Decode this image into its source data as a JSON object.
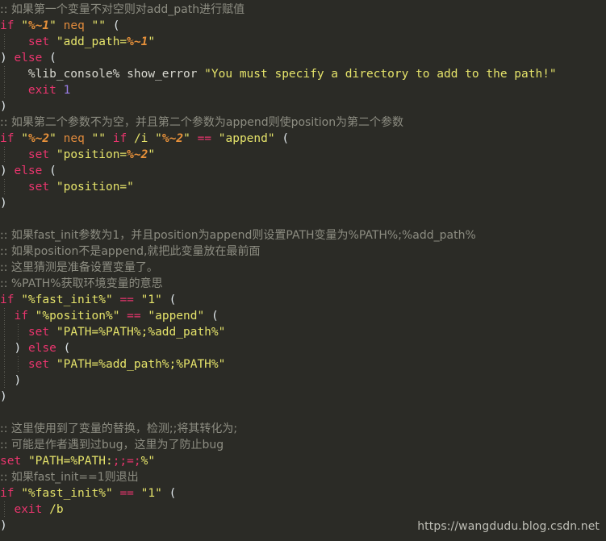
{
  "editor": {
    "background": "#2b2b26",
    "colors": {
      "comment": "#8d8d82",
      "keyword": "#e8356d",
      "string": "#e5e36a",
      "variable": "#e8913a",
      "operator": "#e08a3c",
      "number": "#9a7ee8",
      "plain": "#d8d8d0",
      "paren": "#dfe6ea"
    },
    "language": "batch",
    "lines": [
      {
        "indent": 0,
        "guides": 0,
        "tokens": [
          {
            "t": "cmt",
            "s": ":: 如果第一个变量不对空则对add_path进行赋值"
          }
        ]
      },
      {
        "indent": 0,
        "guides": 0,
        "tokens": [
          {
            "t": "kw",
            "s": "if"
          },
          {
            "t": "pl",
            "s": " "
          },
          {
            "t": "str",
            "s": "\""
          },
          {
            "t": "var",
            "s": "%~1"
          },
          {
            "t": "str",
            "s": "\""
          },
          {
            "t": "pl",
            "s": " "
          },
          {
            "t": "opr",
            "s": "neq"
          },
          {
            "t": "pl",
            "s": " "
          },
          {
            "t": "str",
            "s": "\"\""
          },
          {
            "t": "pl",
            "s": " "
          },
          {
            "t": "par",
            "s": "("
          }
        ]
      },
      {
        "indent": 1,
        "guides": 1,
        "tokens": [
          {
            "t": "pl",
            "s": "    "
          },
          {
            "t": "kw",
            "s": "set"
          },
          {
            "t": "pl",
            "s": " "
          },
          {
            "t": "str",
            "s": "\"add_path="
          },
          {
            "t": "var",
            "s": "%~1"
          },
          {
            "t": "str",
            "s": "\""
          }
        ]
      },
      {
        "indent": 0,
        "guides": 0,
        "tokens": [
          {
            "t": "par",
            "s": ")"
          },
          {
            "t": "pl",
            "s": " "
          },
          {
            "t": "kw",
            "s": "else"
          },
          {
            "t": "pl",
            "s": " "
          },
          {
            "t": "par",
            "s": "("
          }
        ]
      },
      {
        "indent": 1,
        "guides": 1,
        "tokens": [
          {
            "t": "pl",
            "s": "    %lib_console% show_error "
          },
          {
            "t": "str",
            "s": "\"You must specify a directory to add to the path!\""
          }
        ]
      },
      {
        "indent": 1,
        "guides": 1,
        "tokens": [
          {
            "t": "pl",
            "s": "    "
          },
          {
            "t": "kw",
            "s": "exit"
          },
          {
            "t": "pl",
            "s": " "
          },
          {
            "t": "num",
            "s": "1"
          }
        ]
      },
      {
        "indent": 0,
        "guides": 0,
        "tokens": [
          {
            "t": "par",
            "s": ")"
          }
        ]
      },
      {
        "indent": 0,
        "guides": 0,
        "tokens": [
          {
            "t": "cmt",
            "s": ":: 如果第二个参数不为空，并且第二个参数为append则使position为第二个参数"
          }
        ]
      },
      {
        "indent": 0,
        "guides": 0,
        "tokens": [
          {
            "t": "kw",
            "s": "if"
          },
          {
            "t": "pl",
            "s": " "
          },
          {
            "t": "str",
            "s": "\""
          },
          {
            "t": "var",
            "s": "%~2"
          },
          {
            "t": "str",
            "s": "\""
          },
          {
            "t": "pl",
            "s": " "
          },
          {
            "t": "opr",
            "s": "neq"
          },
          {
            "t": "pl",
            "s": " "
          },
          {
            "t": "str",
            "s": "\"\""
          },
          {
            "t": "pl",
            "s": " "
          },
          {
            "t": "kw",
            "s": "if"
          },
          {
            "t": "pl",
            "s": " "
          },
          {
            "t": "sw",
            "s": "/i"
          },
          {
            "t": "pl",
            "s": " "
          },
          {
            "t": "str",
            "s": "\""
          },
          {
            "t": "var",
            "s": "%~2"
          },
          {
            "t": "str",
            "s": "\""
          },
          {
            "t": "pl",
            "s": " "
          },
          {
            "t": "op",
            "s": "=="
          },
          {
            "t": "pl",
            "s": " "
          },
          {
            "t": "str",
            "s": "\"append\""
          },
          {
            "t": "pl",
            "s": " "
          },
          {
            "t": "par",
            "s": "("
          }
        ]
      },
      {
        "indent": 1,
        "guides": 1,
        "tokens": [
          {
            "t": "pl",
            "s": "    "
          },
          {
            "t": "kw",
            "s": "set"
          },
          {
            "t": "pl",
            "s": " "
          },
          {
            "t": "str",
            "s": "\"position="
          },
          {
            "t": "var",
            "s": "%~2"
          },
          {
            "t": "str",
            "s": "\""
          }
        ]
      },
      {
        "indent": 0,
        "guides": 0,
        "tokens": [
          {
            "t": "par",
            "s": ")"
          },
          {
            "t": "pl",
            "s": " "
          },
          {
            "t": "kw",
            "s": "else"
          },
          {
            "t": "pl",
            "s": " "
          },
          {
            "t": "par",
            "s": "("
          }
        ]
      },
      {
        "indent": 1,
        "guides": 1,
        "tokens": [
          {
            "t": "pl",
            "s": "    "
          },
          {
            "t": "kw",
            "s": "set"
          },
          {
            "t": "pl",
            "s": " "
          },
          {
            "t": "str",
            "s": "\"position=\""
          }
        ]
      },
      {
        "indent": 0,
        "guides": 0,
        "tokens": [
          {
            "t": "par",
            "s": ")"
          }
        ]
      },
      {
        "indent": 0,
        "guides": 0,
        "tokens": []
      },
      {
        "indent": 0,
        "guides": 0,
        "tokens": [
          {
            "t": "cmt",
            "s": ":: 如果fast_init参数为1，并且position为append则设置PATH变量为%PATH%;%add_path%"
          }
        ]
      },
      {
        "indent": 0,
        "guides": 0,
        "tokens": [
          {
            "t": "cmt",
            "s": ":: 如果position不是append,就把此变量放在最前面"
          }
        ]
      },
      {
        "indent": 0,
        "guides": 0,
        "tokens": [
          {
            "t": "cmt",
            "s": ":: 这里猜测是准备设置变量了。"
          }
        ]
      },
      {
        "indent": 0,
        "guides": 0,
        "tokens": [
          {
            "t": "cmt",
            "s": ":: %PATH%获取环境变量的意思"
          }
        ]
      },
      {
        "indent": 0,
        "guides": 0,
        "tokens": [
          {
            "t": "kw",
            "s": "if"
          },
          {
            "t": "pl",
            "s": " "
          },
          {
            "t": "str",
            "s": "\"%fast_init%\""
          },
          {
            "t": "pl",
            "s": " "
          },
          {
            "t": "op",
            "s": "=="
          },
          {
            "t": "pl",
            "s": " "
          },
          {
            "t": "str",
            "s": "\"1\""
          },
          {
            "t": "pl",
            "s": " "
          },
          {
            "t": "par",
            "s": "("
          }
        ]
      },
      {
        "indent": 1,
        "guides": 1,
        "tokens": [
          {
            "t": "pl",
            "s": "  "
          },
          {
            "t": "kw",
            "s": "if"
          },
          {
            "t": "pl",
            "s": " "
          },
          {
            "t": "str",
            "s": "\"%position%\""
          },
          {
            "t": "pl",
            "s": " "
          },
          {
            "t": "op",
            "s": "=="
          },
          {
            "t": "pl",
            "s": " "
          },
          {
            "t": "str",
            "s": "\"append\""
          },
          {
            "t": "pl",
            "s": " "
          },
          {
            "t": "par",
            "s": "("
          }
        ]
      },
      {
        "indent": 2,
        "guides": 2,
        "tokens": [
          {
            "t": "pl",
            "s": "    "
          },
          {
            "t": "kw",
            "s": "set"
          },
          {
            "t": "pl",
            "s": " "
          },
          {
            "t": "str",
            "s": "\"PATH=%PATH%;%add_path%\""
          }
        ]
      },
      {
        "indent": 1,
        "guides": 1,
        "tokens": [
          {
            "t": "pl",
            "s": "  "
          },
          {
            "t": "par",
            "s": ")"
          },
          {
            "t": "pl",
            "s": " "
          },
          {
            "t": "kw",
            "s": "else"
          },
          {
            "t": "pl",
            "s": " "
          },
          {
            "t": "par",
            "s": "("
          }
        ]
      },
      {
        "indent": 2,
        "guides": 2,
        "tokens": [
          {
            "t": "pl",
            "s": "    "
          },
          {
            "t": "kw",
            "s": "set"
          },
          {
            "t": "pl",
            "s": " "
          },
          {
            "t": "str",
            "s": "\"PATH=%add_path%;%PATH%\""
          }
        ]
      },
      {
        "indent": 1,
        "guides": 1,
        "tokens": [
          {
            "t": "pl",
            "s": "  "
          },
          {
            "t": "par",
            "s": ")"
          }
        ]
      },
      {
        "indent": 0,
        "guides": 0,
        "tokens": [
          {
            "t": "par",
            "s": ")"
          }
        ]
      },
      {
        "indent": 0,
        "guides": 0,
        "tokens": []
      },
      {
        "indent": 0,
        "guides": 0,
        "tokens": [
          {
            "t": "cmt",
            "s": ":: 这里使用到了变量的替换，检测;;将其转化为;"
          }
        ]
      },
      {
        "indent": 0,
        "guides": 0,
        "tokens": [
          {
            "t": "cmt",
            "s": ":: 可能是作者遇到过bug，这里为了防止bug"
          }
        ]
      },
      {
        "indent": 0,
        "guides": 0,
        "tokens": [
          {
            "t": "kw",
            "s": "set"
          },
          {
            "t": "pl",
            "s": " "
          },
          {
            "t": "str",
            "s": "\"PATH=%PATH:"
          },
          {
            "t": "sub",
            "s": ";;=;"
          },
          {
            "t": "str",
            "s": "%\""
          }
        ]
      },
      {
        "indent": 0,
        "guides": 0,
        "tokens": [
          {
            "t": "cmt",
            "s": ":: 如果fast_init==1则退出"
          }
        ]
      },
      {
        "indent": 0,
        "guides": 0,
        "tokens": [
          {
            "t": "kw",
            "s": "if"
          },
          {
            "t": "pl",
            "s": " "
          },
          {
            "t": "str",
            "s": "\"%fast_init%\""
          },
          {
            "t": "pl",
            "s": " "
          },
          {
            "t": "op",
            "s": "=="
          },
          {
            "t": "pl",
            "s": " "
          },
          {
            "t": "str",
            "s": "\"1\""
          },
          {
            "t": "pl",
            "s": " "
          },
          {
            "t": "par",
            "s": "("
          }
        ]
      },
      {
        "indent": 1,
        "guides": 1,
        "tokens": [
          {
            "t": "pl",
            "s": "  "
          },
          {
            "t": "kw",
            "s": "exit"
          },
          {
            "t": "pl",
            "s": " "
          },
          {
            "t": "sw",
            "s": "/b"
          }
        ]
      },
      {
        "indent": 0,
        "guides": 0,
        "tokens": [
          {
            "t": "par",
            "s": ")"
          }
        ]
      }
    ]
  },
  "watermark": {
    "text": "https://wangdudu.blog.csdn.net"
  }
}
